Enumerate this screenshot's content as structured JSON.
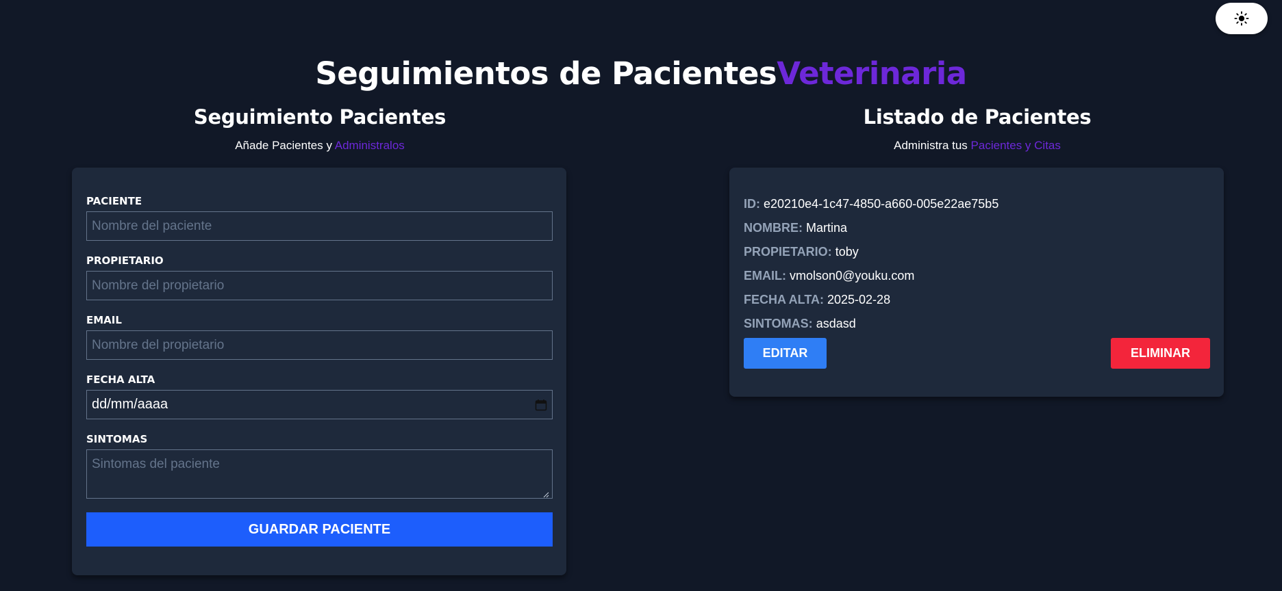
{
  "theme_toggle": {
    "icon": "sun-icon"
  },
  "header": {
    "title": "Seguimientos de Pacientes",
    "title_accent": "Veterinaria"
  },
  "form_section": {
    "title": "Seguimiento Pacientes",
    "subtitle": "Añade Pacientes y ",
    "subtitle_accent": "Administralos",
    "fields": {
      "paciente": {
        "label": "PACIENTE",
        "placeholder": "Nombre del paciente",
        "value": ""
      },
      "propietario": {
        "label": "PROPIETARIO",
        "placeholder": "Nombre del propietario",
        "value": ""
      },
      "email": {
        "label": "EMAIL",
        "placeholder": "Nombre del propietario",
        "value": ""
      },
      "fecha_alta": {
        "label": "FECHA ALTA",
        "value": "dd/mm/aaaa"
      },
      "sintomas": {
        "label": "SINTOMAS",
        "placeholder": "Sintomas del paciente",
        "value": ""
      }
    },
    "submit_label": "GUARDAR PACIENTE"
  },
  "list_section": {
    "title": "Listado de Pacientes",
    "subtitle": "Administra tus ",
    "subtitle_accent": "Pacientes y Citas",
    "patients": [
      {
        "id_label": "ID:",
        "id": "e20210e4-1c47-4850-a660-005e22ae75b5",
        "nombre_label": "NOMBRE:",
        "nombre": "Martina",
        "propietario_label": "PROPIETARIO:",
        "propietario": "toby",
        "email_label": "EMAIL:",
        "email": "vmolson0@youku.com",
        "fecha_label": "FECHA ALTA:",
        "fecha": "2025-02-28",
        "sintomas_label": "SINTOMAS:",
        "sintomas": "asdasd",
        "edit_label": "EDITAR",
        "delete_label": "ELIMINAR"
      }
    ]
  },
  "colors": {
    "background": "#111827",
    "card": "#1e293b",
    "accent_purple": "#6d28d9",
    "primary_blue": "#1d5efc",
    "edit_blue": "#2f7ef5",
    "delete_red": "#f3253b"
  }
}
